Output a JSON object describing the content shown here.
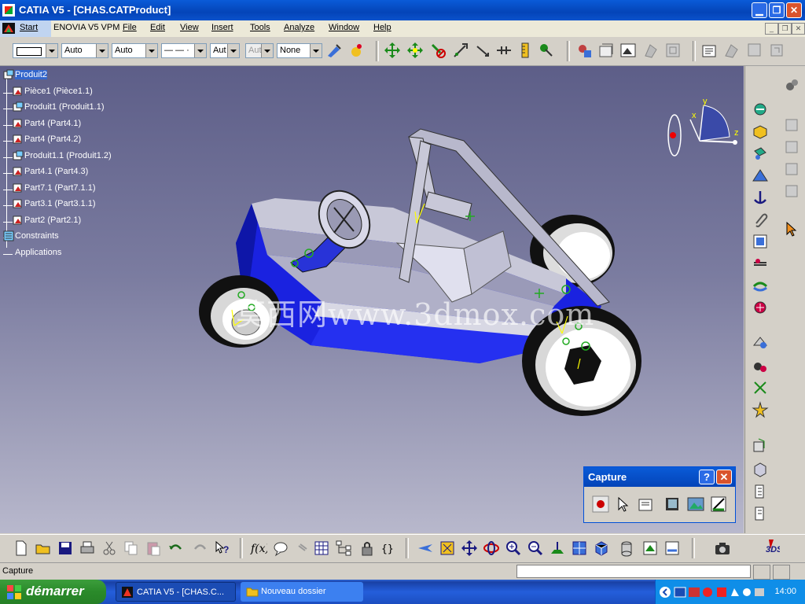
{
  "window": {
    "title": "CATIA V5 - [CHAS.CATProduct]"
  },
  "menu": {
    "start": "Start",
    "items": [
      "ENOVIA V5 VPM",
      "File",
      "Edit",
      "View",
      "Insert",
      "Tools",
      "Analyze",
      "Window",
      "Help"
    ]
  },
  "toolbar": {
    "line_color": "",
    "line_type": "Auto",
    "thickness": "Auto",
    "linetype_pattern": "— — ·",
    "layer": "Aut",
    "layer2": "Aut",
    "rendering": "None"
  },
  "tree": {
    "items": [
      {
        "label": "Produit2",
        "icon": "product-icon",
        "selected": true
      },
      {
        "label": "Pièce1 (Pièce1.1)",
        "icon": "part-icon"
      },
      {
        "label": "Produit1 (Produit1.1)",
        "icon": "product-icon"
      },
      {
        "label": "Part4 (Part4.1)",
        "icon": "part-icon"
      },
      {
        "label": "Part4 (Part4.2)",
        "icon": "part-icon"
      },
      {
        "label": "Produit1.1 (Produit1.2)",
        "icon": "product-icon"
      },
      {
        "label": "Part4.1 (Part4.3)",
        "icon": "part-icon"
      },
      {
        "label": "Part7.1 (Part7.1.1)",
        "icon": "part-icon"
      },
      {
        "label": "Part3.1 (Part3.1.1)",
        "icon": "part-icon"
      },
      {
        "label": "Part2 (Part2.1)",
        "icon": "part-icon"
      },
      {
        "label": "Constraints",
        "icon": "constraints-icon"
      },
      {
        "label": "Applications",
        "icon": "applications-icon"
      }
    ]
  },
  "compass": {
    "x": "x",
    "y": "y",
    "z": "z"
  },
  "watermark": "莫西网www.3dmox.com",
  "capture_panel": {
    "title": "Capture",
    "help": "?",
    "close": "✕"
  },
  "status": {
    "text": "Capture",
    "command": ""
  },
  "taskbar": {
    "start": "démarrer",
    "tasks": [
      {
        "label": "CATIA V5 - [CHAS.C...",
        "active": true
      },
      {
        "label": "Nouveau dossier",
        "active": false
      }
    ],
    "clock": "14:00"
  },
  "colors": {
    "titlebar": "#0a52cc",
    "viewport_top": "#5d5e88",
    "viewport_bottom": "#b8b8cc",
    "body_blue": "#1a22e0",
    "taskbar": "#245edb"
  }
}
